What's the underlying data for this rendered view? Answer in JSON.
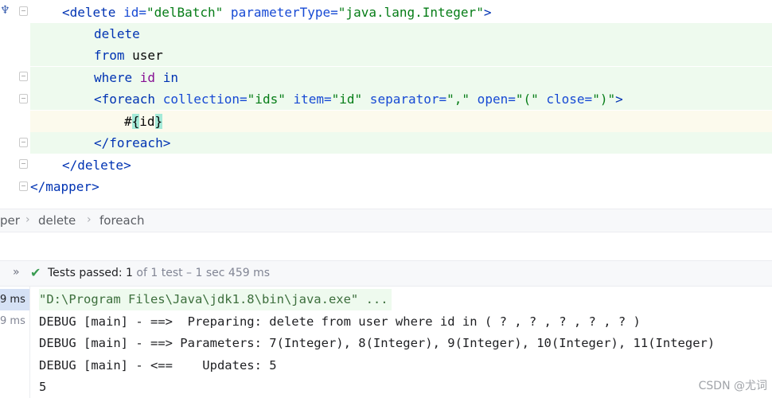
{
  "editor": {
    "lines": {
      "l1": {
        "open": "<delete ",
        "a1": "id=",
        "v1": "\"delBatch\"",
        "a2": " parameterType=",
        "v2": "\"java.lang.Integer\"",
        "close": ">"
      },
      "l2": "delete",
      "l3a": "from",
      "l3b": " user",
      "l4a": "where ",
      "l4b": "id",
      "l4c": " in",
      "l5": {
        "open": "<foreach ",
        "a1": "collection=",
        "v1": "\"ids\"",
        "a2": " item=",
        "v2": "\"id\"",
        "a3": " separator=",
        "v3": "\",\"",
        "a4": " open=",
        "v4": "\"(\"",
        "a5": " close=",
        "v5": "\")\"",
        "close": ">"
      },
      "l6a": "#",
      "l6b": "{",
      "l6c": "id",
      "l6d": "}",
      "l7": "</foreach>",
      "l8": "</delete>",
      "l9": "</mapper>"
    }
  },
  "breadcrumb": {
    "items": [
      "per",
      "delete",
      "foreach"
    ],
    "separator": "›"
  },
  "run": {
    "chevron": "»",
    "check": "✔",
    "status_prefix": "Tests passed: ",
    "status_count": "1",
    "status_suffix": " of 1 test – 1 sec 459 ms"
  },
  "tree": {
    "items": [
      "9 ms",
      "9 ms"
    ]
  },
  "console": {
    "lines": [
      "\"D:\\Program Files\\Java\\jdk1.8\\bin\\java.exe\" ...",
      "DEBUG [main] - ==>  Preparing: delete from user where id in ( ? , ? , ? , ? , ? )",
      "DEBUG [main] - ==> Parameters: 7(Integer), 8(Integer), 9(Integer), 10(Integer), 11(Integer)",
      "DEBUG [main] - <==    Updates: 5",
      "5"
    ]
  },
  "watermark": "CSDN @尤词",
  "colors": {
    "tag": "#0033b3",
    "string": "#067d17",
    "highlight": "#eefaee",
    "match": "#a5ead8",
    "pass": "#3a9c52"
  }
}
